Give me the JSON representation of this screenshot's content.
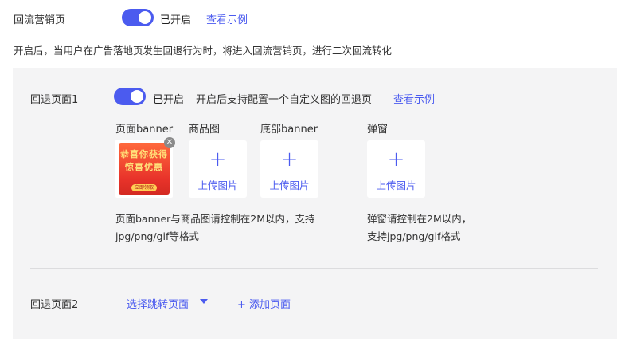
{
  "header": {
    "label": "回流营销页",
    "status": "已开启",
    "example_link": "查看示例",
    "description": "开启后，当用户在广告落地页发生回退行为时，将进入回流营销页，进行二次回流转化"
  },
  "page1": {
    "label": "回退页面1",
    "status": "已开启",
    "note": "开启后支持配置一个自定义图的回退页",
    "example_link": "查看示例",
    "columns": {
      "banner": "页面banner",
      "product": "商品图",
      "bottom": "底部banner",
      "popup": "弹窗"
    },
    "banner_image": {
      "line1": "恭喜你获得",
      "line2": "惊喜优惠",
      "button": "立即领取"
    },
    "upload_label": "上传图片",
    "hint_left_1": "页面banner与商品图请控制在2M以内，支持",
    "hint_left_2": "jpg/png/gif等格式",
    "hint_right_1": "弹窗请控制在2M以内，",
    "hint_right_2": "支持jpg/png/gif格式"
  },
  "page2": {
    "label": "回退页面2",
    "select_link": "选择跳转页面",
    "add_link": "添加页面",
    "add_icon": "+"
  },
  "colors": {
    "accent": "#4b5bef",
    "panel_bg": "#f4f4f5"
  }
}
